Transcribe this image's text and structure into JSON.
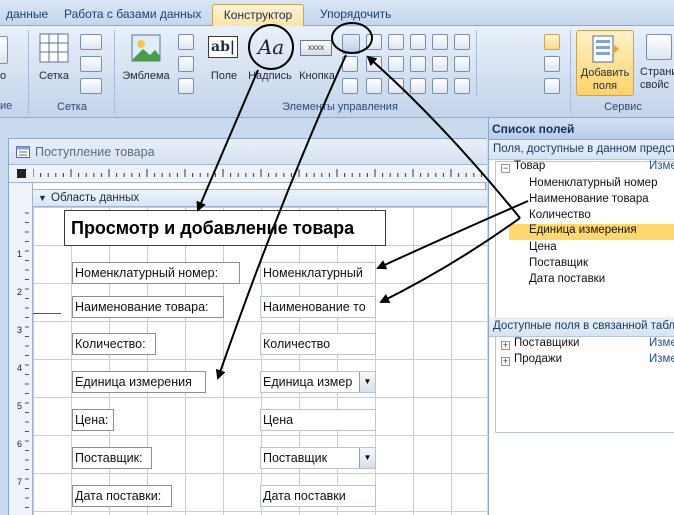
{
  "ribbon": {
    "tabs": [
      "данные",
      "Работа с базами данных",
      "Конструктор",
      "Упорядочить"
    ],
    "active_tab": "Конструктор",
    "groups": {
      "grid": {
        "label": "Сетка",
        "button": "Сетка"
      },
      "controls": {
        "label": "Элементы управления",
        "emblem": "Эмблема",
        "field": "Поле",
        "caption": "Надпись",
        "button": "Кнопка"
      },
      "tools": {
        "label": "Сервис",
        "add_fields": "Добавить поля",
        "props_line1": "Страни",
        "props_line2": "свойс"
      }
    },
    "left_cut": [
      "о",
      "ие"
    ]
  },
  "designer": {
    "window_title": "Поступление товара",
    "section_title": "Область данных",
    "form_title": "Просмотр  и добавление товара",
    "rows": [
      {
        "label": "Номенклатурный номер:",
        "field": "Номенклатурный",
        "combo": false
      },
      {
        "label": "Наименование товара:",
        "field": "Наименование то",
        "combo": false
      },
      {
        "label": "Количество:",
        "field": "Количество",
        "combo": false
      },
      {
        "label": "Единица измерения",
        "field": "Единица измер",
        "combo": true
      },
      {
        "label": "Цена:",
        "field": "Цена",
        "combo": false
      },
      {
        "label": "Поставщик:",
        "field": "Поставщик",
        "combo": true
      },
      {
        "label": "Дата поставки:",
        "field": "Дата поставки",
        "combo": false
      }
    ],
    "ruler_numbers": [
      "1",
      "2",
      "3",
      "4",
      "5",
      "6",
      "7"
    ]
  },
  "field_list": {
    "title": "Список полей",
    "available_header": "Поля, доступные в данном предст",
    "table_name": "Товар",
    "edit_label": "Изме",
    "fields": [
      "Номенклатурный номер",
      "Наименование товара",
      "Количество",
      "Единица измерения",
      "Цена",
      "Поставщик",
      "Дата поставки"
    ],
    "selected_field": "Единица измерения",
    "related_header": "Доступные поля в связанной табл",
    "related_tables": [
      {
        "name": "Поставщики",
        "edit": "Изме"
      },
      {
        "name": "Продажи",
        "edit": "Изме"
      }
    ]
  }
}
